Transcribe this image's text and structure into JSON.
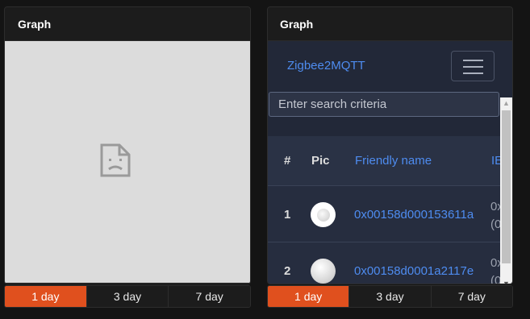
{
  "left_card": {
    "title": "Graph",
    "tabs": [
      "1 day",
      "3 day",
      "7 day"
    ],
    "active_tab": "1 day",
    "content_icon": "broken-page-icon"
  },
  "right_card": {
    "title": "Graph",
    "brand": "Zigbee2MQTT",
    "search_placeholder": "Enter search criteria",
    "table": {
      "headers": [
        "#",
        "Pic",
        "Friendly name",
        "IE"
      ],
      "rows": [
        {
          "num": "1",
          "friendly_name": "0x00158d000153611a",
          "ieee_line1": "0x",
          "ieee_line2": "(0"
        },
        {
          "num": "2",
          "friendly_name": "0x00158d0001a2117e",
          "ieee_line1": "0x",
          "ieee_line2": "(0"
        }
      ]
    },
    "tabs": [
      "1 day",
      "3 day",
      "7 day"
    ],
    "active_tab": "1 day"
  },
  "colors": {
    "accent": "#e0501e",
    "link": "#4e8cf0",
    "panel": "#222838"
  }
}
